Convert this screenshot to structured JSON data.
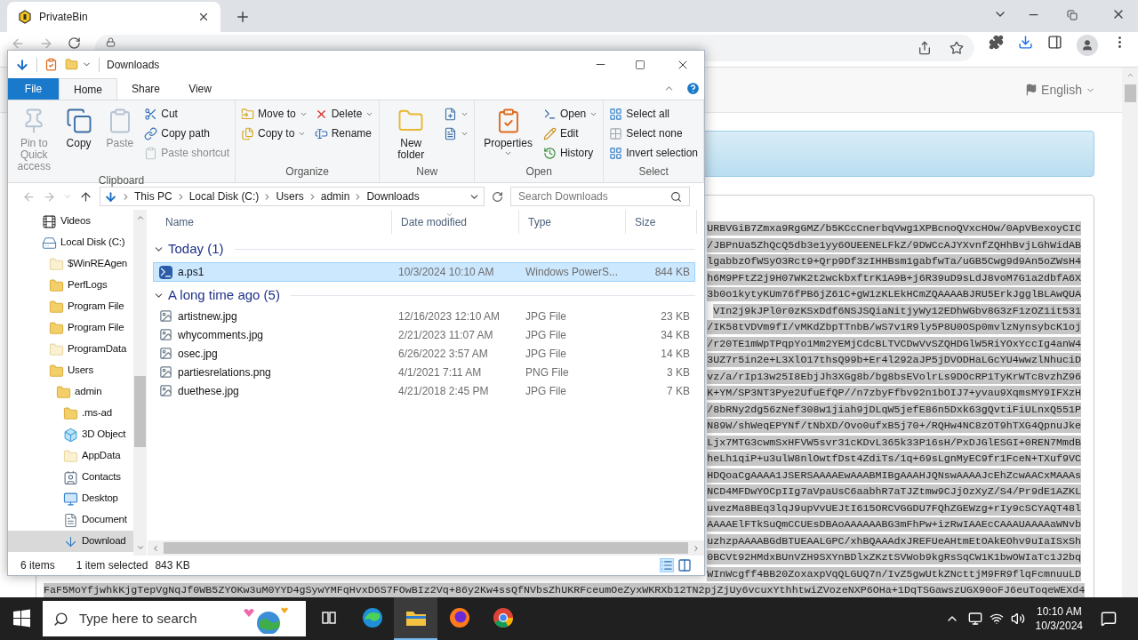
{
  "browser": {
    "tab": {
      "title": "PrivateBin"
    },
    "language": "English",
    "paste_lines": [
      {
        "kind": "right",
        "text": "URBVGiB7Zmxa9RgGMZ/b5KCcCnerbqVwg1XPBcnoQVxcHOw/0ApVBexoyCIC"
      },
      {
        "kind": "right",
        "text": "/JBPnUa5ZhQcQ5db3e1yy6OUEENELFkZ/9DWCcAJYXvnfZQHhBvjLGhWidAB"
      },
      {
        "kind": "right",
        "text": "lgabbzOfWSyO3Rct9+Qrp9Df3zIHHBsm1gabfwTa/uGB5Cwg9d9An5oZWsH4"
      },
      {
        "kind": "right",
        "text": "h6M9PFtZ2j9H07WK2t2wckbxftrK1A9B+j6R39uD9sLdJ8voM7G1a2dbfA6X"
      },
      {
        "kind": "right",
        "text": "3b0o1kytyKUm76fPB6jZ61C+gW1zKLEkHCmZQAAAABJRU5ErkJgglBLAwQUA"
      },
      {
        "kind": "right",
        "text": "VIn2j9kJPl0r0zKSxDdf6NSJSQiaNitjyWy12EDhWGbv8G3zF1zOZ1it531"
      },
      {
        "kind": "right",
        "text": "/IK58tVDVm9fI/vMKdZbpTTnbB/wS7v1R9ly5P8U0OSp0mvlzNynsybcK1oj"
      },
      {
        "kind": "right",
        "text": "/r20TE1mWpTPqpYo1Mm2YEMjCdcBLTVCDwVvSZQHDGlW5RiYOxYccIg4anW4"
      },
      {
        "kind": "right",
        "text": "3UZ7r5in2e+L3XlO17thsQ99b+Er4l292aJP5jDVODHaLGcYU4wwzlNhuciD"
      },
      {
        "kind": "right",
        "text": "vz/a/rIp13w25I8EbjJh3XGg8b/bg8bsEVolrLs9DOcRP1TyKrWTc8vzhZ96"
      },
      {
        "kind": "right",
        "text": "K+YM/SP3NT3Pye2UfuEfQP//n7zbyFfbv92n1bOIJ7+yvau9XqmsMY9IFXzH"
      },
      {
        "kind": "right",
        "text": "/8bRNy2dg56zNef308w1jiah9jDLqW5jefE86n5Dxk63gQvtiFiULnxQ551P"
      },
      {
        "kind": "right",
        "text": "N89W/shWeqEPYNf/tNbXD/Ovo0ufxB5j70+/RQHw4NC8zOT9hTXG4QpnuJke"
      },
      {
        "kind": "right",
        "text": "Ljx7MTG3cwmSxHFVW5svr31cKDvL365k33P16sH/PxDJGlESGI+0REN7MmdB"
      },
      {
        "kind": "right",
        "text": "heLh1qiP+u3ulW8nlOwtfDst4ZdiTs/1q+69sLgnMyEC9fr1FceN+TXuf9VC"
      },
      {
        "kind": "right",
        "text": "HDQoaCgAAAA1JSERSAAAAEwAAABMIBgAAAHJQNswAAAAJcEhZcwAACxMAAAs"
      },
      {
        "kind": "right",
        "text": "NCD4MFDwYOCpIIg7aVpaUsC6aabhR7aTJZtmw9CJjOzXyZ/S4/Pr9dE1AZKL"
      },
      {
        "kind": "right",
        "text": "uvezMa8BEq3lqJ9upVvUEJtI615ORCVGGDU7FQhZGEWzg+rIy9cSCYAQT48l"
      },
      {
        "kind": "right",
        "text": "AAAAElFTkSuQmCCUEsDBAoAAAAAABG3mFhPw+izRwIAAEcCAAAUAAAAaWNvb"
      },
      {
        "kind": "right",
        "text": "uzhzpAAAABGdBTUEAALGPC/xhBQAAAdxJREFUeAHtmEtOAkEOhv9uIaISxSh"
      },
      {
        "kind": "right",
        "text": "0BCVt92HMdxBUnVZH9SXYnBDlxZKztSVWob9kgRsSqCW1K1bwOWIaTc1J2bq"
      },
      {
        "kind": "right",
        "text": "WInWcgff4BB20ZoxaxpVqQLGUQ7n/IvZ5gwUtkZNcttjM9FR9flqFcmnuuLD"
      },
      {
        "kind": "full",
        "text": "FaF5MoYfjwhkKjgTepVgNqJf0WB5ZYOKw3uM0YYD4gSywYMFqHvxD6S7FOwBIz2Vq+86y2Kw4ssQfNVbsZhUKRFceumOeZyxWKRXb12TN2pjZjUy6vcuxYthhtwiZVozeNXP6OHa+1DqTSGawszUGX90oFJ6euToqeWEXd4"
      }
    ]
  },
  "explorer": {
    "title": "Downloads",
    "ribbon_tabs": [
      {
        "label": "File",
        "kind": "menu",
        "selected": false
      },
      {
        "label": "Home",
        "kind": "tab",
        "selected": true
      },
      {
        "label": "Share",
        "kind": "tab",
        "selected": false
      },
      {
        "label": "View",
        "kind": "tab",
        "selected": false
      }
    ],
    "ribbon_groups": [
      {
        "label": "Clipboard",
        "columns": [
          [
            {
              "label": "Pin to Quick access",
              "kind": "large",
              "disabled": true,
              "dropdown": false
            }
          ],
          [
            {
              "label": "Copy",
              "kind": "large",
              "disabled": false,
              "dropdown": false
            }
          ],
          [
            {
              "label": "Paste",
              "kind": "large",
              "disabled": true,
              "dropdown": false
            }
          ],
          [
            {
              "label": "Cut",
              "kind": "small",
              "disabled": false,
              "dropdown": false
            },
            {
              "label": "Copy path",
              "kind": "small",
              "disabled": false,
              "dropdown": false
            },
            {
              "label": "Paste shortcut",
              "kind": "small",
              "disabled": true,
              "dropdown": false
            }
          ]
        ]
      },
      {
        "label": "Organize",
        "columns": [
          [
            {
              "label": "Move to",
              "kind": "small",
              "disabled": false,
              "dropdown": true
            },
            {
              "label": "Copy to",
              "kind": "small",
              "disabled": false,
              "dropdown": true
            }
          ],
          [
            {
              "label": "Delete",
              "kind": "small",
              "disabled": false,
              "dropdown": true
            },
            {
              "label": "Rename",
              "kind": "small",
              "disabled": false,
              "dropdown": false
            }
          ]
        ]
      },
      {
        "label": "New",
        "columns": [
          [
            {
              "label": "New folder",
              "kind": "large",
              "disabled": false,
              "dropdown": false
            }
          ],
          [
            {
              "kind": "small",
              "disabled": false,
              "dropdown": true
            },
            {
              "kind": "small",
              "disabled": false,
              "dropdown": true
            }
          ]
        ]
      },
      {
        "label": "Open",
        "columns": [
          [
            {
              "label": "Properties",
              "kind": "large",
              "disabled": false,
              "dropdown": true
            }
          ],
          [
            {
              "label": "Open",
              "kind": "small",
              "disabled": false,
              "dropdown": true
            },
            {
              "label": "Edit",
              "kind": "small",
              "disabled": false,
              "dropdown": false
            },
            {
              "label": "History",
              "kind": "small",
              "disabled": false,
              "dropdown": false
            }
          ]
        ]
      },
      {
        "label": "Select",
        "columns": [
          [
            {
              "label": "Select all",
              "kind": "small",
              "disabled": false,
              "dropdown": false
            },
            {
              "label": "Select none",
              "kind": "small",
              "disabled": false,
              "dropdown": false
            },
            {
              "label": "Invert selection",
              "kind": "small",
              "disabled": false,
              "dropdown": false
            }
          ]
        ]
      }
    ],
    "address": {
      "crumbs": [
        "This PC",
        "Local Disk (C:)",
        "Users",
        "admin",
        "Downloads"
      ],
      "search_placeholder": "Search Downloads"
    },
    "nav": [
      {
        "label": "Videos",
        "kind": "video",
        "selected": false
      },
      {
        "label": "Local Disk (C:)",
        "kind": "drive",
        "selected": false,
        "children": [
          {
            "label": "$WinREAgen",
            "kind": "hidden",
            "selected": false
          },
          {
            "label": "PerfLogs",
            "kind": "folder",
            "selected": false
          },
          {
            "label": "Program File",
            "kind": "folder",
            "selected": false
          },
          {
            "label": "Program File",
            "kind": "folder",
            "selected": false
          },
          {
            "label": "ProgramData",
            "kind": "hidden",
            "selected": false
          },
          {
            "label": "Users",
            "kind": "folder",
            "selected": false,
            "children": [
              {
                "label": "admin",
                "kind": "folder",
                "selected": false,
                "children": [
                  {
                    "label": ".ms-ad",
                    "kind": "folder",
                    "selected": false
                  },
                  {
                    "label": "3D Object",
                    "kind": "cube",
                    "selected": false
                  },
                  {
                    "label": "AppData",
                    "kind": "hidden",
                    "selected": false
                  },
                  {
                    "label": "Contacts",
                    "kind": "contacts",
                    "selected": false
                  },
                  {
                    "label": "Desktop",
                    "kind": "desktop",
                    "selected": false
                  },
                  {
                    "label": "Document",
                    "kind": "documents",
                    "selected": false
                  },
                  {
                    "label": "Download",
                    "kind": "downloads",
                    "selected": true
                  }
                ]
              }
            ]
          }
        ]
      }
    ],
    "columns": [
      "Name",
      "Date modified",
      "Type",
      "Size"
    ],
    "groups": [
      {
        "label": "Today (1)",
        "expanded": true,
        "files": [
          {
            "name": "a.ps1",
            "date": "10/3/2024 10:10 AM",
            "type": "Windows PowerS...",
            "size": "844 KB",
            "kind": "script",
            "selected": true
          }
        ]
      },
      {
        "label": "A long time ago (5)",
        "expanded": true,
        "files": [
          {
            "name": "artistnew.jpg",
            "date": "12/16/2023 12:10 AM",
            "type": "JPG File",
            "size": "23 KB",
            "kind": "image",
            "selected": false
          },
          {
            "name": "whycomments.jpg",
            "date": "2/21/2023 11:07 AM",
            "type": "JPG File",
            "size": "34 KB",
            "kind": "image",
            "selected": false
          },
          {
            "name": "osec.jpg",
            "date": "6/26/2022 3:57 AM",
            "type": "JPG File",
            "size": "14 KB",
            "kind": "image",
            "selected": false
          },
          {
            "name": "partiesrelations.png",
            "date": "4/1/2021 7:11 AM",
            "type": "PNG File",
            "size": "3 KB",
            "kind": "image",
            "selected": false
          },
          {
            "name": "duethese.jpg",
            "date": "4/21/2018 2:45 PM",
            "type": "JPG File",
            "size": "7 KB",
            "kind": "image",
            "selected": false
          }
        ]
      }
    ],
    "status": {
      "count": "6 items",
      "selection": "1 item selected",
      "size": "843 KB"
    }
  },
  "taskbar": {
    "search_placeholder": "Type here to search",
    "apps": [
      {
        "kind": "taskview",
        "active": false
      },
      {
        "kind": "edge",
        "active": false
      },
      {
        "kind": "explorer",
        "active": true
      },
      {
        "kind": "firefox",
        "active": false
      },
      {
        "kind": "chrome",
        "active": false
      }
    ],
    "time": "10:10 AM",
    "date": "10/3/2024"
  }
}
